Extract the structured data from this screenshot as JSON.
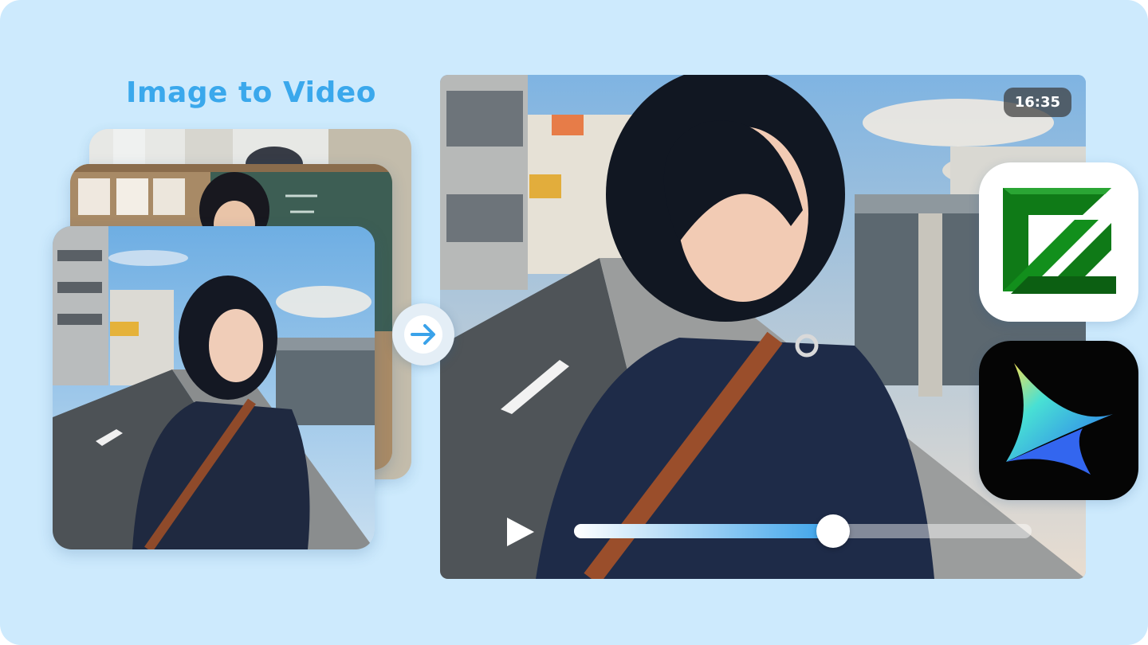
{
  "title": "Image to Video",
  "colors": {
    "background": "#cdeafd",
    "accent": "#3aa2ea",
    "title": "#3aa8ec"
  },
  "input_images": [
    {
      "layer": "back",
      "description_icon": "classroom-photo"
    },
    {
      "layer": "middle",
      "description_icon": "chalkboard-photo"
    },
    {
      "layer": "front",
      "description_icon": "street-portrait-photo"
    }
  ],
  "convert_arrow": {
    "icon": "arrow-right-icon"
  },
  "player": {
    "timestamp": "16:35",
    "progress": 0.566,
    "play_icon": "play-icon"
  },
  "apps": [
    {
      "id": "ffmpeg",
      "icon": "ffmpeg-logo-icon"
    },
    {
      "id": "filmora",
      "icon": "four-point-star-logo-icon"
    }
  ]
}
